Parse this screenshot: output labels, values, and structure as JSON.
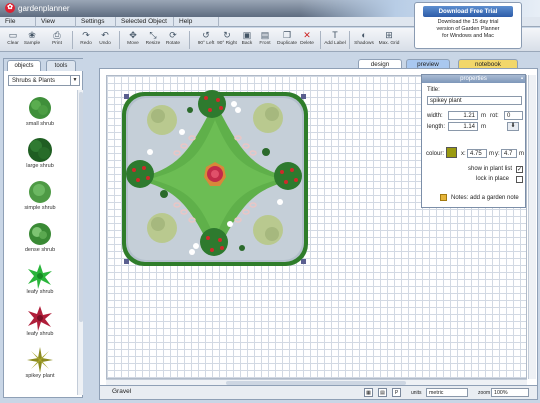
{
  "app": {
    "logo_text": "gardenplanner"
  },
  "menu": [
    "File",
    "View",
    "Settings",
    "Selected Object",
    "Help"
  ],
  "toolbar": [
    {
      "label": "Clear",
      "icon": "clear-icon",
      "glyph": "▭"
    },
    {
      "label": "Sample",
      "icon": "sample-icon",
      "glyph": "❀"
    },
    {
      "label": "Print",
      "icon": "print-icon",
      "glyph": "⎙"
    },
    {
      "label": "Redo",
      "icon": "redo-icon",
      "glyph": "↷"
    },
    {
      "label": "Undo",
      "icon": "undo-icon",
      "glyph": "↶"
    },
    {
      "label": "Move",
      "icon": "move-icon",
      "glyph": "✥"
    },
    {
      "label": "Resize",
      "icon": "resize-icon",
      "glyph": "⤡"
    },
    {
      "label": "Rotate",
      "icon": "rotate-icon",
      "glyph": "⟳"
    },
    {
      "label": "90° Left",
      "icon": "rotate-left-icon",
      "glyph": "↺"
    },
    {
      "label": "90° Right",
      "icon": "rotate-right-icon",
      "glyph": "↻"
    },
    {
      "label": "Back",
      "icon": "send-back-icon",
      "glyph": "▣"
    },
    {
      "label": "Front",
      "icon": "bring-front-icon",
      "glyph": "▤"
    },
    {
      "label": "Duplicate",
      "icon": "duplicate-icon",
      "glyph": "❐"
    },
    {
      "label": "Delete",
      "icon": "delete-icon",
      "glyph": "✕"
    },
    {
      "label": "Add Label",
      "icon": "label-icon",
      "glyph": "T"
    },
    {
      "label": "Shadows",
      "icon": "shadows-icon",
      "glyph": "◐"
    },
    {
      "label": "Max. Grid",
      "icon": "grid-icon",
      "glyph": "⊞"
    }
  ],
  "trial": {
    "button": "Download Free Trial",
    "line1": "Download the 15 day trial",
    "line2": "version of Garden Planner",
    "line3": "for Windows and Mac"
  },
  "left_panel": {
    "tabs": [
      "objects",
      "tools"
    ],
    "category": "Shrubs & Plants",
    "items": [
      {
        "label": "small shrub",
        "color": "#3f8f3a"
      },
      {
        "label": "large shrub",
        "color": "#1f5e22"
      },
      {
        "label": "simple shrub",
        "color": "#4e9a45"
      },
      {
        "label": "dense shrub",
        "color": "#3a8a35"
      },
      {
        "label": "leafy shrub",
        "color": "#29b53a"
      },
      {
        "label": "leafy shrub",
        "color": "#b01e3a"
      },
      {
        "label": "spikey plant",
        "color": "#8b8a1e"
      }
    ]
  },
  "view_tabs": [
    "design",
    "preview",
    "notebook"
  ],
  "properties": {
    "header": "properties",
    "title_label": "Title:",
    "title_value": "spikey plant",
    "width_label": "width:",
    "width_value": "1.21",
    "length_label": "length:",
    "length_value": "1.14",
    "unit": "m",
    "rot_label": "rot:",
    "rot_value": "0",
    "colour_label": "colour:",
    "colour_value": "#9a9a10",
    "x_label": "x:",
    "x_value": "4.75",
    "y_label": "y:",
    "y_value": "4.7",
    "show_in_list": "show in plant list",
    "lock_in_place": "lock in place",
    "notes": "Notes: add a garden note"
  },
  "status": {
    "selected_material": "Gravel",
    "units_label": "units",
    "units_value": "metric",
    "zoom_label": "zoom",
    "zoom_value": "100%"
  }
}
